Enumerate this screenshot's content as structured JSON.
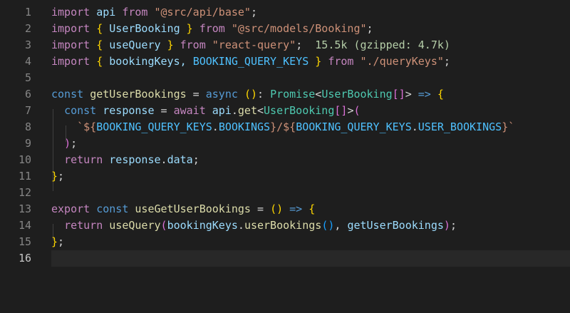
{
  "editor": {
    "lines": [
      {
        "n": "1",
        "tokens": [
          {
            "t": "import",
            "c": "kw"
          },
          {
            "t": " api ",
            "c": "id"
          },
          {
            "t": "from",
            "c": "kw"
          },
          {
            "t": " ",
            "c": "pl"
          },
          {
            "t": "\"@src/api/base\"",
            "c": "str"
          },
          {
            "t": ";",
            "c": "pl"
          }
        ]
      },
      {
        "n": "2",
        "tokens": [
          {
            "t": "import",
            "c": "kw"
          },
          {
            "t": " ",
            "c": "pl"
          },
          {
            "t": "{",
            "c": "br1"
          },
          {
            "t": " UserBooking ",
            "c": "id"
          },
          {
            "t": "}",
            "c": "br1"
          },
          {
            "t": " ",
            "c": "pl"
          },
          {
            "t": "from",
            "c": "kw"
          },
          {
            "t": " ",
            "c": "pl"
          },
          {
            "t": "\"@src/models/Booking\"",
            "c": "str"
          },
          {
            "t": ";",
            "c": "pl"
          }
        ]
      },
      {
        "n": "3",
        "tokens": [
          {
            "t": "import",
            "c": "kw"
          },
          {
            "t": " ",
            "c": "pl"
          },
          {
            "t": "{",
            "c": "br1"
          },
          {
            "t": " useQuery ",
            "c": "id"
          },
          {
            "t": "}",
            "c": "br1"
          },
          {
            "t": " ",
            "c": "pl"
          },
          {
            "t": "from",
            "c": "kw"
          },
          {
            "t": " ",
            "c": "pl"
          },
          {
            "t": "\"react-query\"",
            "c": "str"
          },
          {
            "t": ";",
            "c": "pl"
          },
          {
            "t": "  15.5k (gzipped: 4.7k)",
            "c": "info"
          }
        ]
      },
      {
        "n": "4",
        "tokens": [
          {
            "t": "import",
            "c": "kw"
          },
          {
            "t": " ",
            "c": "pl"
          },
          {
            "t": "{",
            "c": "br1"
          },
          {
            "t": " bookingKeys, ",
            "c": "id"
          },
          {
            "t": "BOOKING_QUERY_KEYS",
            "c": "cst"
          },
          {
            "t": " ",
            "c": "pl"
          },
          {
            "t": "}",
            "c": "br1"
          },
          {
            "t": " ",
            "c": "pl"
          },
          {
            "t": "from",
            "c": "kw"
          },
          {
            "t": " ",
            "c": "pl"
          },
          {
            "t": "\"./queryKeys\"",
            "c": "str"
          },
          {
            "t": ";",
            "c": "pl"
          }
        ]
      },
      {
        "n": "5",
        "tokens": []
      },
      {
        "n": "6",
        "tokens": [
          {
            "t": "const",
            "c": "kw2"
          },
          {
            "t": " ",
            "c": "pl"
          },
          {
            "t": "getUserBookings",
            "c": "fn"
          },
          {
            "t": " = ",
            "c": "pl"
          },
          {
            "t": "async",
            "c": "kw2"
          },
          {
            "t": " ",
            "c": "pl"
          },
          {
            "t": "()",
            "c": "br1"
          },
          {
            "t": ": ",
            "c": "pl"
          },
          {
            "t": "Promise",
            "c": "ty"
          },
          {
            "t": "<",
            "c": "pl"
          },
          {
            "t": "UserBooking",
            "c": "ty"
          },
          {
            "t": "[]",
            "c": "br2"
          },
          {
            "t": "> ",
            "c": "pl"
          },
          {
            "t": "=>",
            "c": "kw2"
          },
          {
            "t": " ",
            "c": "pl"
          },
          {
            "t": "{",
            "c": "br1"
          }
        ]
      },
      {
        "n": "7",
        "tokens": [
          {
            "t": "  ",
            "c": "pl"
          },
          {
            "t": "const",
            "c": "kw2"
          },
          {
            "t": " ",
            "c": "pl"
          },
          {
            "t": "response",
            "c": "id"
          },
          {
            "t": " = ",
            "c": "pl"
          },
          {
            "t": "await",
            "c": "kw"
          },
          {
            "t": " ",
            "c": "pl"
          },
          {
            "t": "api",
            "c": "id"
          },
          {
            "t": ".",
            "c": "pl"
          },
          {
            "t": "get",
            "c": "fn"
          },
          {
            "t": "<",
            "c": "pl"
          },
          {
            "t": "UserBooking",
            "c": "ty"
          },
          {
            "t": "[]",
            "c": "br2"
          },
          {
            "t": ">",
            "c": "pl"
          },
          {
            "t": "(",
            "c": "br2"
          }
        ]
      },
      {
        "n": "8",
        "tokens": [
          {
            "t": "    ",
            "c": "pl"
          },
          {
            "t": "`${",
            "c": "str"
          },
          {
            "t": "BOOKING_QUERY_KEYS",
            "c": "cst"
          },
          {
            "t": ".",
            "c": "pl"
          },
          {
            "t": "BOOKINGS",
            "c": "cst"
          },
          {
            "t": "}",
            "c": "str"
          },
          {
            "t": "/",
            "c": "str"
          },
          {
            "t": "${",
            "c": "str"
          },
          {
            "t": "BOOKING_QUERY_KEYS",
            "c": "cst"
          },
          {
            "t": ".",
            "c": "pl"
          },
          {
            "t": "USER_BOOKINGS",
            "c": "cst"
          },
          {
            "t": "}`",
            "c": "str"
          }
        ]
      },
      {
        "n": "9",
        "tokens": [
          {
            "t": "  ",
            "c": "pl"
          },
          {
            "t": ")",
            "c": "br2"
          },
          {
            "t": ";",
            "c": "pl"
          }
        ]
      },
      {
        "n": "10",
        "tokens": [
          {
            "t": "  ",
            "c": "pl"
          },
          {
            "t": "return",
            "c": "kw"
          },
          {
            "t": " ",
            "c": "pl"
          },
          {
            "t": "response",
            "c": "id"
          },
          {
            "t": ".",
            "c": "pl"
          },
          {
            "t": "data",
            "c": "id"
          },
          {
            "t": ";",
            "c": "pl"
          }
        ]
      },
      {
        "n": "11",
        "tokens": [
          {
            "t": "}",
            "c": "br1"
          },
          {
            "t": ";",
            "c": "pl"
          }
        ]
      },
      {
        "n": "12",
        "tokens": []
      },
      {
        "n": "13",
        "tokens": [
          {
            "t": "export",
            "c": "kw"
          },
          {
            "t": " ",
            "c": "pl"
          },
          {
            "t": "const",
            "c": "kw2"
          },
          {
            "t": " ",
            "c": "pl"
          },
          {
            "t": "useGetUserBookings",
            "c": "fn"
          },
          {
            "t": " = ",
            "c": "pl"
          },
          {
            "t": "()",
            "c": "br1"
          },
          {
            "t": " ",
            "c": "pl"
          },
          {
            "t": "=>",
            "c": "kw2"
          },
          {
            "t": " ",
            "c": "pl"
          },
          {
            "t": "{",
            "c": "br1"
          }
        ]
      },
      {
        "n": "14",
        "tokens": [
          {
            "t": "  ",
            "c": "pl"
          },
          {
            "t": "return",
            "c": "kw"
          },
          {
            "t": " ",
            "c": "pl"
          },
          {
            "t": "useQuery",
            "c": "fn"
          },
          {
            "t": "(",
            "c": "br2"
          },
          {
            "t": "bookingKeys",
            "c": "id"
          },
          {
            "t": ".",
            "c": "pl"
          },
          {
            "t": "userBookings",
            "c": "fn"
          },
          {
            "t": "()",
            "c": "br3"
          },
          {
            "t": ", ",
            "c": "pl"
          },
          {
            "t": "getUserBookings",
            "c": "id"
          },
          {
            "t": ")",
            "c": "br2"
          },
          {
            "t": ";",
            "c": "pl"
          }
        ]
      },
      {
        "n": "15",
        "tokens": [
          {
            "t": "}",
            "c": "br1"
          },
          {
            "t": ";",
            "c": "pl"
          }
        ]
      },
      {
        "n": "16",
        "tokens": []
      }
    ],
    "current_line": "16"
  }
}
